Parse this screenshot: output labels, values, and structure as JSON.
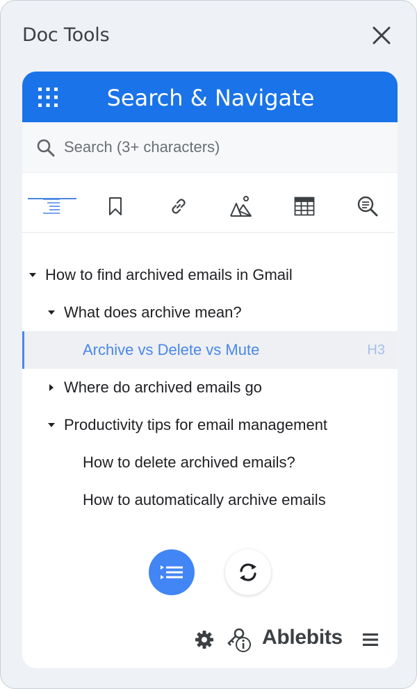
{
  "sidebar": {
    "title": "Doc Tools",
    "close_icon": "close-icon"
  },
  "header": {
    "apps_icon": "apps-grid-icon",
    "title": "Search & Navigate",
    "color": "#1a73e8"
  },
  "search": {
    "icon": "search-icon",
    "placeholder": "Search (3+ characters)",
    "value": ""
  },
  "tabs": [
    {
      "name": "headings",
      "icon": "headings-icon",
      "active": true
    },
    {
      "name": "bookmarks",
      "icon": "bookmark-icon",
      "active": false
    },
    {
      "name": "links",
      "icon": "link-icon",
      "active": false
    },
    {
      "name": "images",
      "icon": "image-icon",
      "active": false
    },
    {
      "name": "tables",
      "icon": "table-icon",
      "active": false
    },
    {
      "name": "find",
      "icon": "find-icon",
      "active": false
    }
  ],
  "tree": [
    {
      "label": "How to find archived emails in Gmail",
      "expanded": true,
      "has_children": true,
      "level": 1
    },
    {
      "label": "What does archive mean?",
      "expanded": true,
      "has_children": true,
      "level": 2
    },
    {
      "label": "Archive vs Delete vs Mute",
      "selected": true,
      "level": 3,
      "tag": "H3"
    },
    {
      "label": "Where do archived emails go",
      "expanded": false,
      "has_children": true,
      "level": 2
    },
    {
      "label": "Productivity tips for email management",
      "expanded": true,
      "has_children": true,
      "level": 2
    },
    {
      "label": "How to delete archived emails?",
      "level": 3
    },
    {
      "label": "How to automatically archive emails",
      "level": 3
    }
  ],
  "actions": {
    "primary_icon": "list-outline-icon",
    "secondary_icon": "refresh-icon"
  },
  "footer": {
    "settings_icon": "gear-icon",
    "license_icon": "key-info-icon",
    "brand": "Ablebits",
    "menu_icon": "hamburger-menu-icon"
  },
  "colors": {
    "accent": "#4a86e8",
    "selected_bg": "#eef0f4",
    "panel_bg": "#eef1f6"
  }
}
